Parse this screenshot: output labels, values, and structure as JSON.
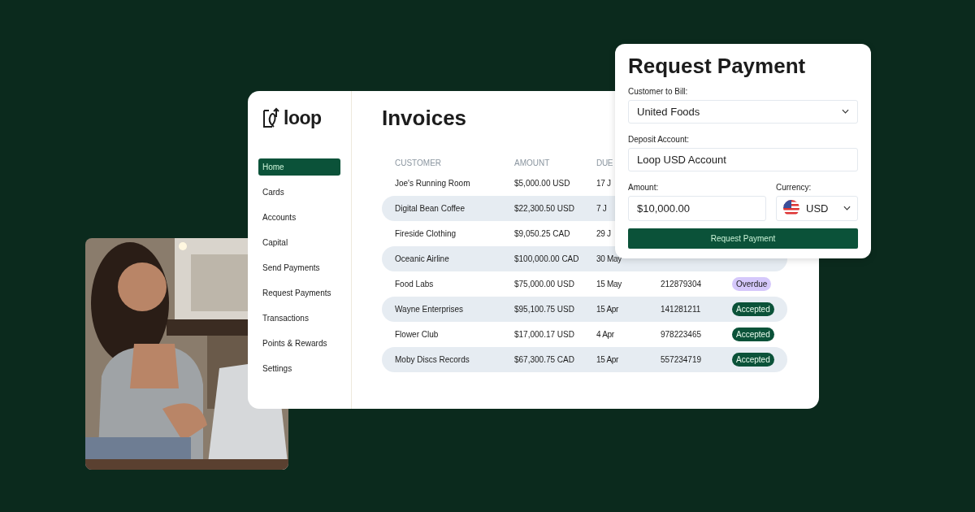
{
  "sidebar": {
    "logo": "loop",
    "items": [
      {
        "label": "Home",
        "selected": true
      },
      {
        "label": "Cards",
        "selected": false
      },
      {
        "label": "Accounts",
        "selected": false
      },
      {
        "label": "Capital",
        "selected": false
      },
      {
        "label": "Send Payments",
        "selected": false
      },
      {
        "label": "Request Payments",
        "selected": false
      },
      {
        "label": "Transactions",
        "selected": false
      },
      {
        "label": "Points & Rewards",
        "selected": false
      },
      {
        "label": "Settings",
        "selected": false
      }
    ]
  },
  "invoices": {
    "title": "Invoices",
    "columns": [
      "CUSTOMER",
      "AMOUNT",
      "DUE"
    ],
    "rows": [
      {
        "customer": "Joe's Running Room",
        "amount": "$5,000.00 USD",
        "due": "17 J"
      },
      {
        "customer": "Digital Bean Coffee",
        "amount": "$22,300.50 USD",
        "due": "7 J"
      },
      {
        "customer": "Fireside Clothing",
        "amount": "$9,050.25 CAD",
        "due": "29 J"
      },
      {
        "customer": "Oceanic Airline",
        "amount": "$100,000.00 CAD",
        "due": "30 May"
      },
      {
        "customer": "Food Labs",
        "amount": "$75,000.00 USD",
        "due": "15 May",
        "number": "212879304",
        "status": {
          "label": "Overdue",
          "kind": "overdue"
        }
      },
      {
        "customer": "Wayne Enterprises",
        "amount": "$95,100.75 USD",
        "due": "15 Apr",
        "number": "141281211",
        "status": {
          "label": "Accepted",
          "kind": "accepted"
        }
      },
      {
        "customer": "Flower Club",
        "amount": "$17,000.17 USD",
        "due": "4 Apr",
        "number": "978223465",
        "status": {
          "label": "Accepted",
          "kind": "accepted"
        }
      },
      {
        "customer": "Moby Discs Records",
        "amount": "$67,300.75 CAD",
        "due": "15 Apr",
        "number": "557234719",
        "status": {
          "label": "Accepted",
          "kind": "accepted"
        }
      }
    ]
  },
  "request_payment": {
    "title": "Request Payment",
    "customer": {
      "label": "Customer to Bill:",
      "value": "United Foods"
    },
    "deposit": {
      "label": "Deposit Account:",
      "value": "Loop USD Account"
    },
    "amount": {
      "label": "Amount:",
      "value": "$10,000.00"
    },
    "currency": {
      "label": "Currency:",
      "value": "USD"
    },
    "button": "Request Payment"
  }
}
